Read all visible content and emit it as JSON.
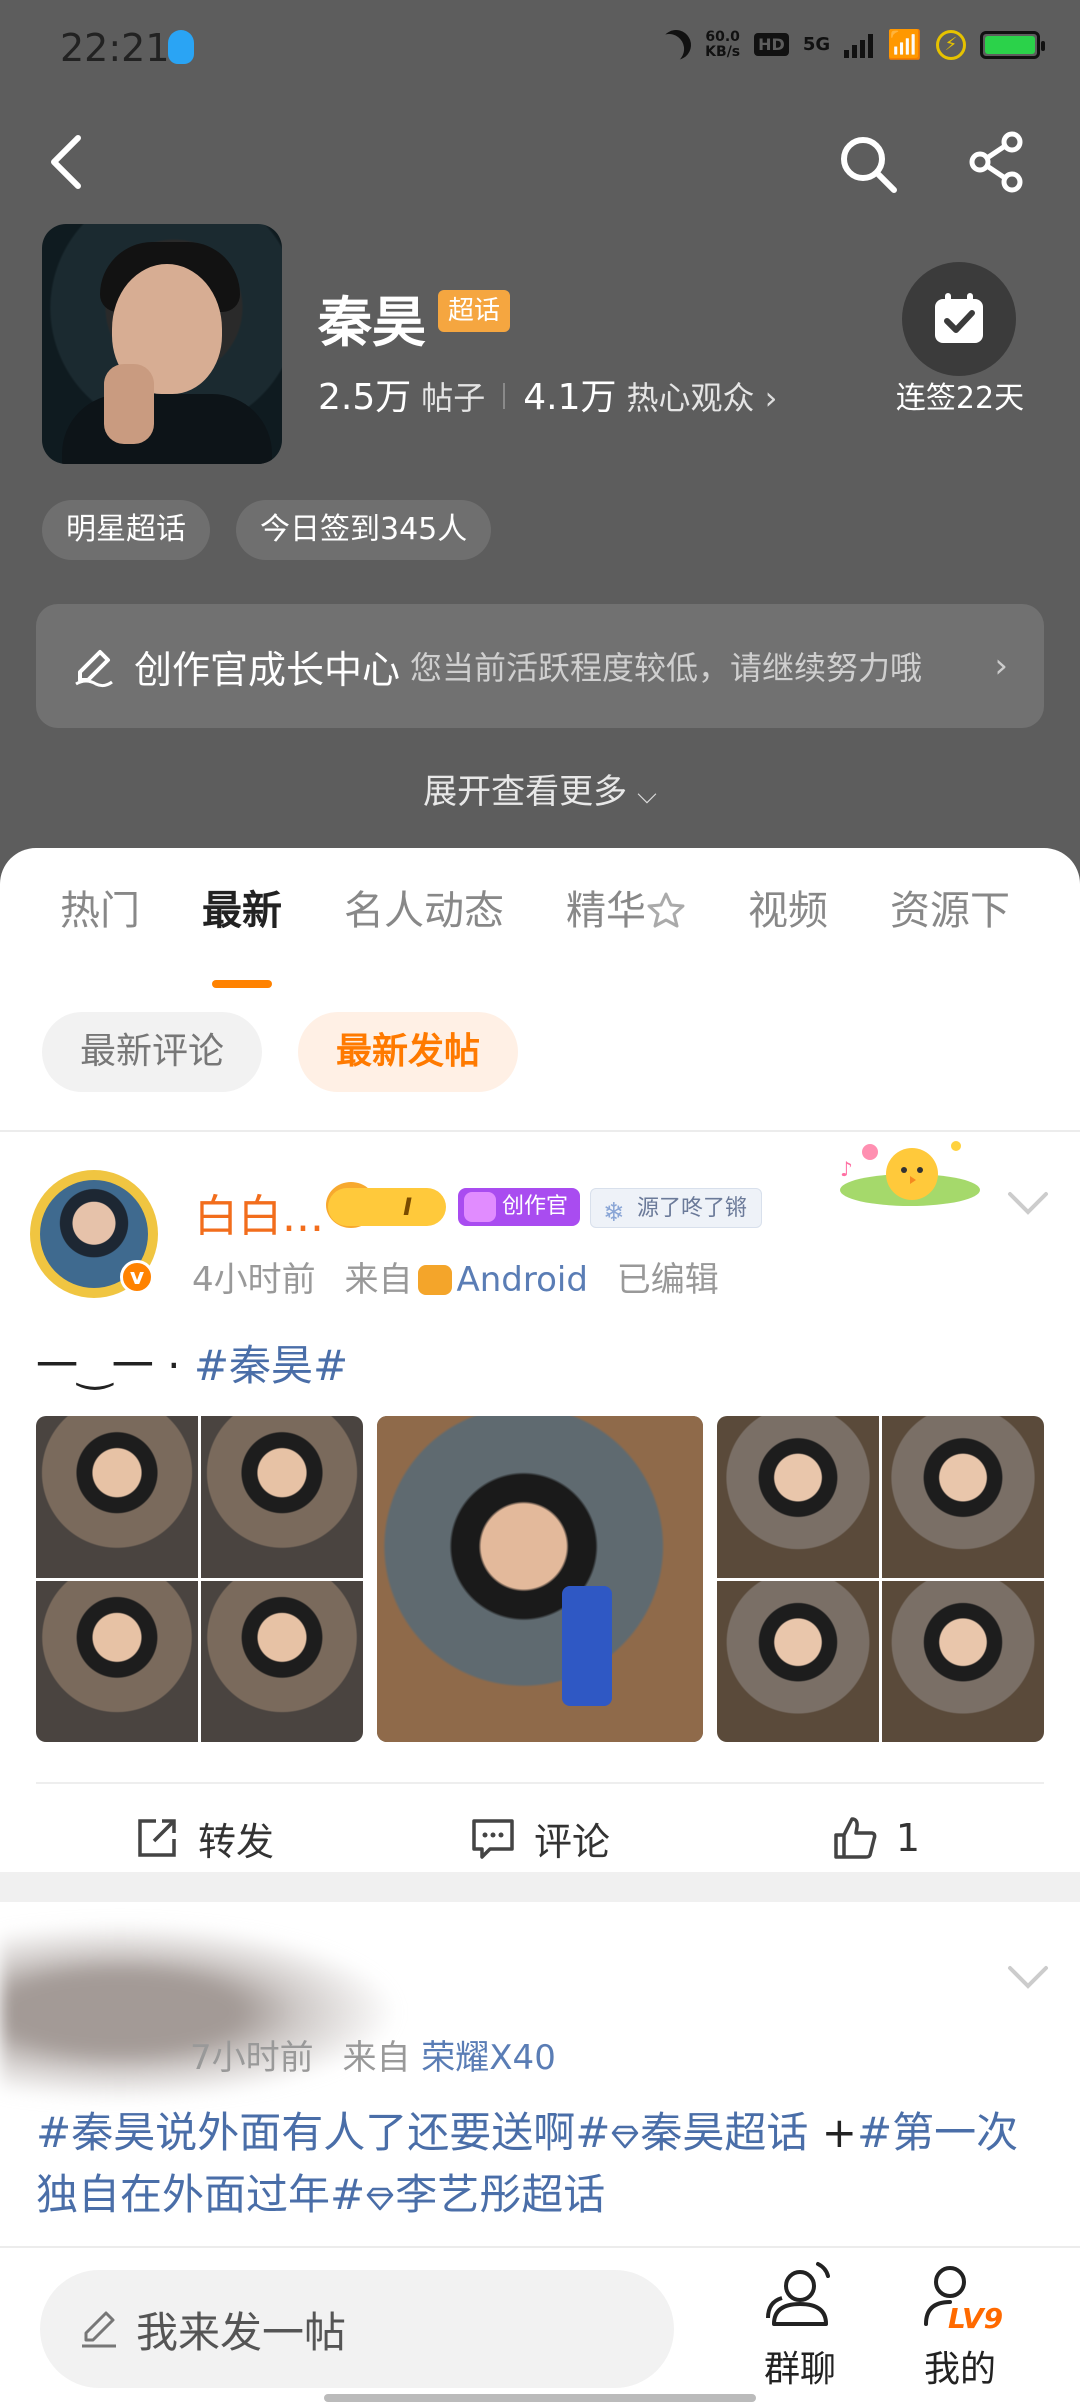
{
  "status_bar": {
    "time": "22:21",
    "net_speed_value": "60.0",
    "net_speed_unit": "KB/s",
    "hd": "HD",
    "network": "5G"
  },
  "header": {
    "title": "秦昊",
    "badge": "超话",
    "posts_count": "2.5万",
    "posts_label": "帖子",
    "fans_count": "4.1万",
    "fans_label": "热心观众",
    "chevron": "›",
    "checkin_text": "连签22天",
    "chips": [
      "明星超话",
      "今日签到345人"
    ],
    "creator_title": "创作官成长中心",
    "creator_desc": "您当前活跃程度较低，请继续努力哦",
    "expand_label": "展开查看更多",
    "expand_chevron": "⌵"
  },
  "tabs": [
    "热门",
    "最新",
    "名人动态",
    "精华",
    "视频",
    "资源下"
  ],
  "active_tab": "最新",
  "subtabs": [
    "最新评论",
    "最新发帖"
  ],
  "active_subtab": "最新发帖",
  "post1": {
    "user": "白白...",
    "level": "I",
    "creator_tag": "创作官",
    "fan_tag": "源了咚了锵",
    "time": "4小时前",
    "from_label": "来自",
    "source": "Android",
    "edited": "已编辑",
    "text_prefix": "一‿一 · ",
    "text_tag": "#秦昊#",
    "repost_label": "转发",
    "comment_label": "评论",
    "like_count": "1"
  },
  "post2": {
    "time": "7小时前",
    "from_label": "来自",
    "source": "荣耀X40",
    "text_a": "#秦昊说外面有人了还要送啊#",
    "text_b": "秦昊超话",
    "text_plus": " +",
    "text_c": "#第一次独自在外面过年#",
    "text_d": "李艺彤超话"
  },
  "bottom": {
    "compose_placeholder": "我来发一帖",
    "group_chat": "群聊",
    "mine": "我的",
    "mine_level": "LV9"
  },
  "colors": {
    "accent": "#ff8200",
    "link": "#4a6ea8",
    "header_bg": "#5d5d5d"
  },
  "icons": [
    "back-icon",
    "search-icon",
    "share-icon",
    "calendar-check-icon",
    "creator-pen-icon",
    "chevron-down-icon",
    "repost-icon",
    "comment-icon",
    "like-icon",
    "pencil-icon",
    "group-chat-icon",
    "profile-icon"
  ]
}
